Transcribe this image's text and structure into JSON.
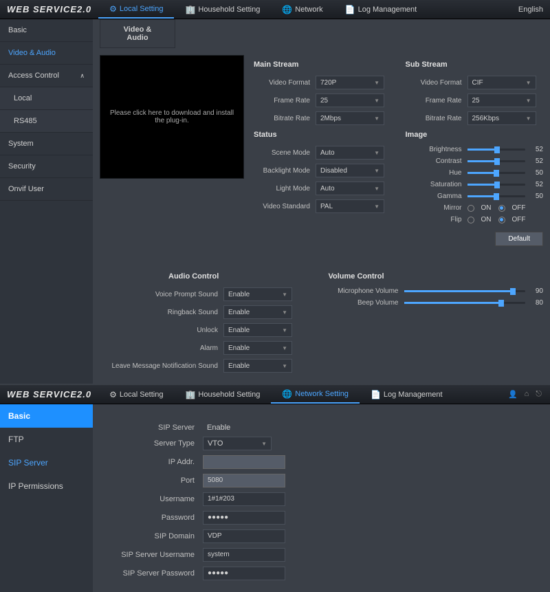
{
  "top": {
    "logo": "WEB SERVICE2.0",
    "nav": {
      "local": "Local Setting",
      "household": "Household Setting",
      "network": "Network",
      "log": "Log Management"
    },
    "lang": "English"
  },
  "sidebar": {
    "basic": "Basic",
    "video_audio": "Video & Audio",
    "access_control": "Access Control",
    "local": "Local",
    "rs485": "RS485",
    "system": "System",
    "security": "Security",
    "onvif": "Onvif User"
  },
  "tab": "Video & Audio",
  "preview_text": "Please click here to download and install the plug-in.",
  "main_stream": {
    "title": "Main Stream",
    "video_format_label": "Video Format",
    "video_format": "720P",
    "frame_rate_label": "Frame Rate",
    "frame_rate": "25",
    "bitrate_rate_label": "Bitrate Rate",
    "bitrate_rate": "2Mbps"
  },
  "status": {
    "title": "Status",
    "scene_mode_label": "Scene Mode",
    "scene_mode": "Auto",
    "backlight_label": "Backlight Mode",
    "backlight": "Disabled",
    "light_label": "Light Mode",
    "light": "Auto",
    "vs_label": "Video Standard",
    "vs": "PAL"
  },
  "sub_stream": {
    "title": "Sub Stream",
    "video_format": "CIF",
    "frame_rate": "25",
    "bitrate_rate": "256Kbps"
  },
  "image": {
    "title": "Image",
    "brightness_label": "Brightness",
    "brightness": 52,
    "contrast_label": "Contrast",
    "contrast": 52,
    "hue_label": "Hue",
    "hue": 50,
    "saturation_label": "Saturation",
    "saturation": 52,
    "gamma_label": "Gamma",
    "gamma": 50,
    "mirror_label": "Mirror",
    "flip_label": "Flip",
    "on": "ON",
    "off": "OFF"
  },
  "default_btn": "Default",
  "audio": {
    "title": "Audio Control",
    "voice_label": "Voice Prompt Sound",
    "voice": "Enable",
    "ringback_label": "Ringback Sound",
    "ringback": "Enable",
    "unlock_label": "Unlock",
    "unlock": "Enable",
    "alarm_label": "Alarm",
    "alarm": "Enable",
    "leave_label": "Leave Message Notification Sound",
    "leave": "Enable"
  },
  "volume": {
    "title": "Volume Control",
    "mic_label": "Microphone Volume",
    "mic": 90,
    "beep_label": "Beep Volume",
    "beep": 80
  },
  "top2": {
    "nav": {
      "local": "Local Setting",
      "household": "Household Setting",
      "network": "Network Setting",
      "log": "Log Management"
    }
  },
  "sidebar2": {
    "basic": "Basic",
    "ftp": "FTP",
    "sip": "SIP Server",
    "ip": "IP Permissions"
  },
  "sip": {
    "server_label": "SIP Server",
    "server": "Enable",
    "type_label": "Server Type",
    "type": "VTO",
    "ip_label": "IP Addr.",
    "ip": "",
    "port_label": "Port",
    "port": "5080",
    "user_label": "Username",
    "user": "1#1#203",
    "pass_label": "Password",
    "pass": "●●●●●",
    "domain_label": "SIP Domain",
    "domain": "VDP",
    "suser_label": "SIP Server Username",
    "suser": "system",
    "spass_label": "SIP Server Password",
    "spass": "●●●●●"
  }
}
